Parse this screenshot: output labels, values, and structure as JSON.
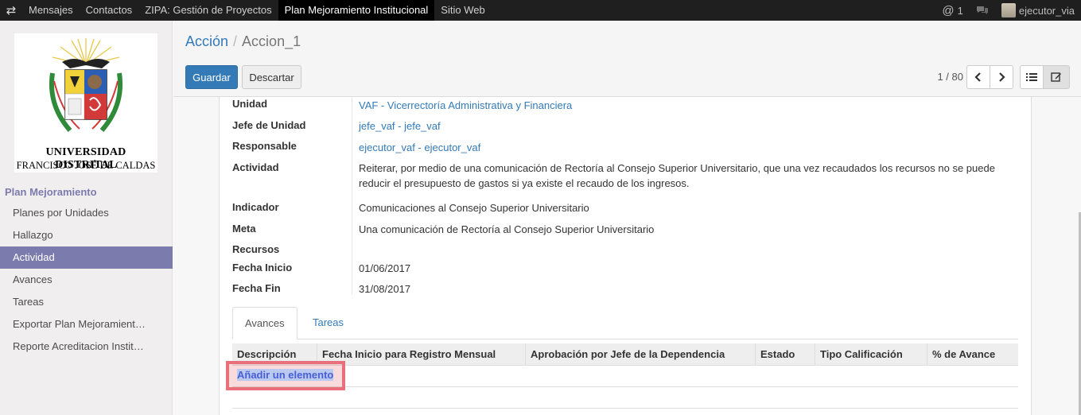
{
  "topbar": {
    "menu": [
      "Mensajes",
      "Contactos",
      "ZIPA: Gestión de Proyectos",
      "Plan Mejoramiento Institucional",
      "Sitio Web"
    ],
    "active_index": 3,
    "mentions_count": "1",
    "user": "ejecutor_via"
  },
  "sidebar": {
    "logo_line1": "UNIVERSIDAD DISTRITAL",
    "logo_line2": "FRANCISCO JOSÉ DE CALDAS",
    "section_title": "Plan Mejoramiento",
    "items": [
      "Planes por Unidades",
      "Hallazgo",
      "Actividad",
      "Avances",
      "Tareas",
      "Exportar Plan Mejoramient…",
      "Reporte Acreditacion Instit…"
    ],
    "active_index": 2
  },
  "cpanel": {
    "breadcrumb_parent": "Acción",
    "breadcrumb_current": "Accion_1",
    "save_label": "Guardar",
    "discard_label": "Descartar",
    "pager": "1 / 80"
  },
  "form": {
    "unidad_label": "Unidad",
    "unidad_value": "VAF - Vicerrectoría Administrativa y Financiera",
    "jefe_label": "Jefe de Unidad",
    "jefe_value": "jefe_vaf - jefe_vaf",
    "responsable_label": "Responsable",
    "responsable_value": "ejecutor_vaf - ejecutor_vaf",
    "actividad_label": "Actividad",
    "actividad_value": "Reiterar, por medio de una comunicación de Rectoría al Consejo Superior Universitario, que una vez recaudados los recursos no se puede reducir el presupuesto de gastos si ya existe el recaudo de los ingresos.",
    "indicador_label": "Indicador",
    "indicador_value": "Comunicaciones al Consejo Superior Universitario",
    "meta_label": "Meta",
    "meta_value": "Una comunicación de Rectoría al Consejo Superior Universitario",
    "recursos_label": "Recursos",
    "fecha_inicio_label": "Fecha Inicio",
    "fecha_inicio_value": "01/06/2017",
    "fecha_fin_label": "Fecha Fin",
    "fecha_fin_value": "31/08/2017"
  },
  "tabs": [
    "Avances",
    "Tareas"
  ],
  "grid": {
    "columns": [
      "Descripción",
      "Fecha Inicio para Registro Mensual",
      "Aprobación por Jefe de la Dependencia",
      "Estado",
      "Tipo Calificación",
      "% de Avance"
    ],
    "add_label": "Añadir un elemento"
  }
}
